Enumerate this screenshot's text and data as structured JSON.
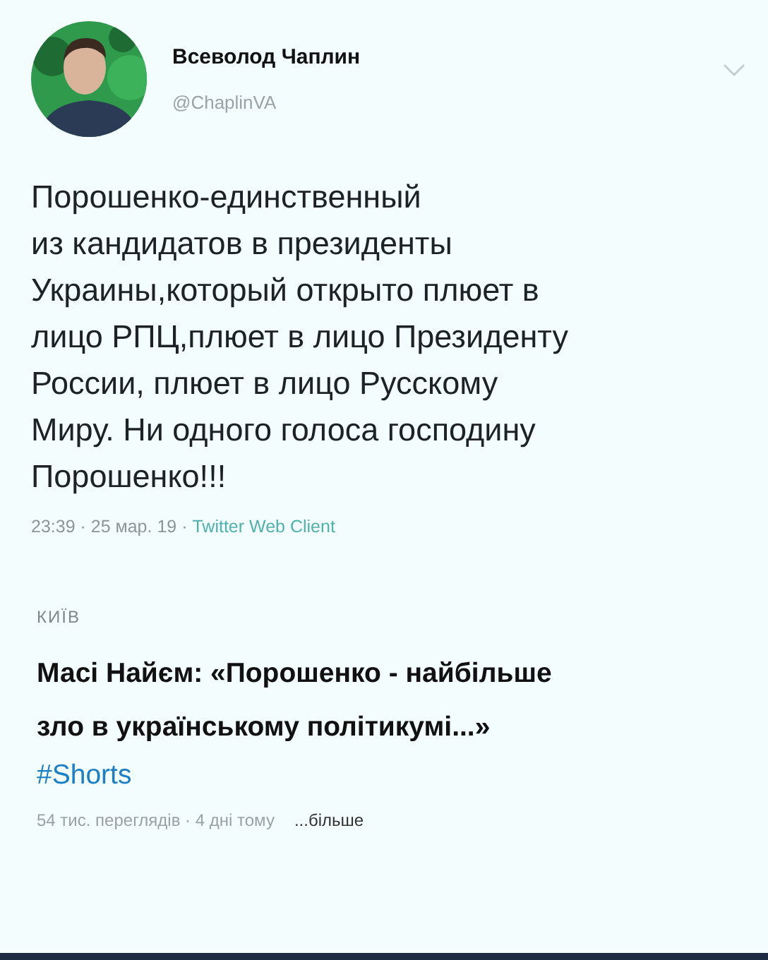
{
  "tweet": {
    "author": {
      "name": "Всеволод Чаплин",
      "handle": "@ChaplinVA"
    },
    "text": "Порошенко-единственный\nиз кандидатов в президенты\nУкраины,который открыто плюет  в\nлицо РПЦ,плюет в лицо Президенту\nРоссии, плюет в лицо Русскому\nМиру. Ни одного голоса господину\nПорошенко!!!",
    "time": "23:39 · 25 мар. 19 · ",
    "source": "Twitter Web Client"
  },
  "video": {
    "location": "КИЇВ",
    "title": "Масі Найєм: «Порошенко - найбільше\nзло в українському політикумі...»",
    "hashtag": "#Shorts",
    "stats": "54 тис. переглядів · 4 дні тому",
    "more": "...більше"
  }
}
